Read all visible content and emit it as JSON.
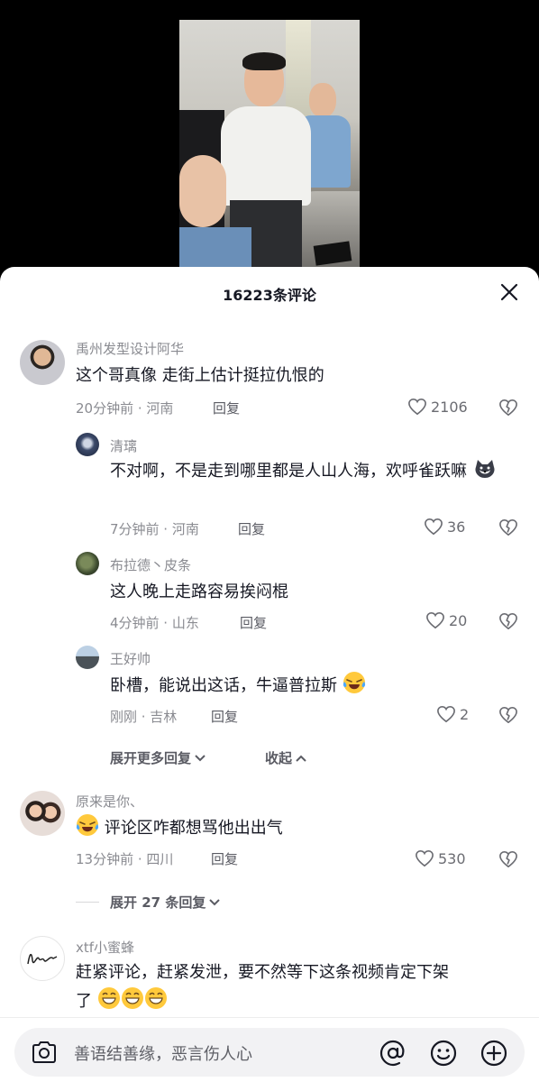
{
  "sheet": {
    "title": "16223条评论"
  },
  "comments": [
    {
      "username": "禹州发型设计阿华",
      "text": "这个哥真像  走街上估计挺拉仇恨的",
      "time_location": "20分钟前 · 河南",
      "reply_label": "回复",
      "likes": "2106",
      "replies": [
        {
          "username": "清璃",
          "text": "不对啊，不是走到哪里都是人山人海，欢呼雀跃嘛",
          "time_location": "7分钟前 · 河南",
          "reply_label": "回复",
          "likes": "36"
        },
        {
          "username": "布拉德丶皮条",
          "text": "这人晚上走路容易挨闷棍",
          "time_location": "4分钟前 · 山东",
          "reply_label": "回复",
          "likes": "20"
        },
        {
          "username": "王好帅",
          "text": "卧槽，能说出这话，牛逼普拉斯",
          "time_location": "刚刚 · 吉林",
          "reply_label": "回复",
          "likes": "2"
        }
      ],
      "expand_more_label": "展开更多回复",
      "collapse_label": "收起"
    },
    {
      "username": "原来是你、",
      "text": "评论区咋都想骂他出出气",
      "time_location": "13分钟前 · 四川",
      "reply_label": "回复",
      "likes": "530",
      "expand_label": "展开 27 条回复"
    },
    {
      "username": "xtf小蜜蜂",
      "text_line1": "赶紧评论，赶紧发泄，要不然等下这条视频肯定下架",
      "text_line2": "了"
    }
  ],
  "input": {
    "placeholder": "善语结善缘，恶言伤人心"
  },
  "icons": {
    "close": "close-icon",
    "heart": "heart-icon",
    "dislike": "broken-heart-icon",
    "camera": "camera-icon",
    "mention": "at-icon",
    "emoji": "emoji-icon",
    "add": "plus-icon"
  }
}
